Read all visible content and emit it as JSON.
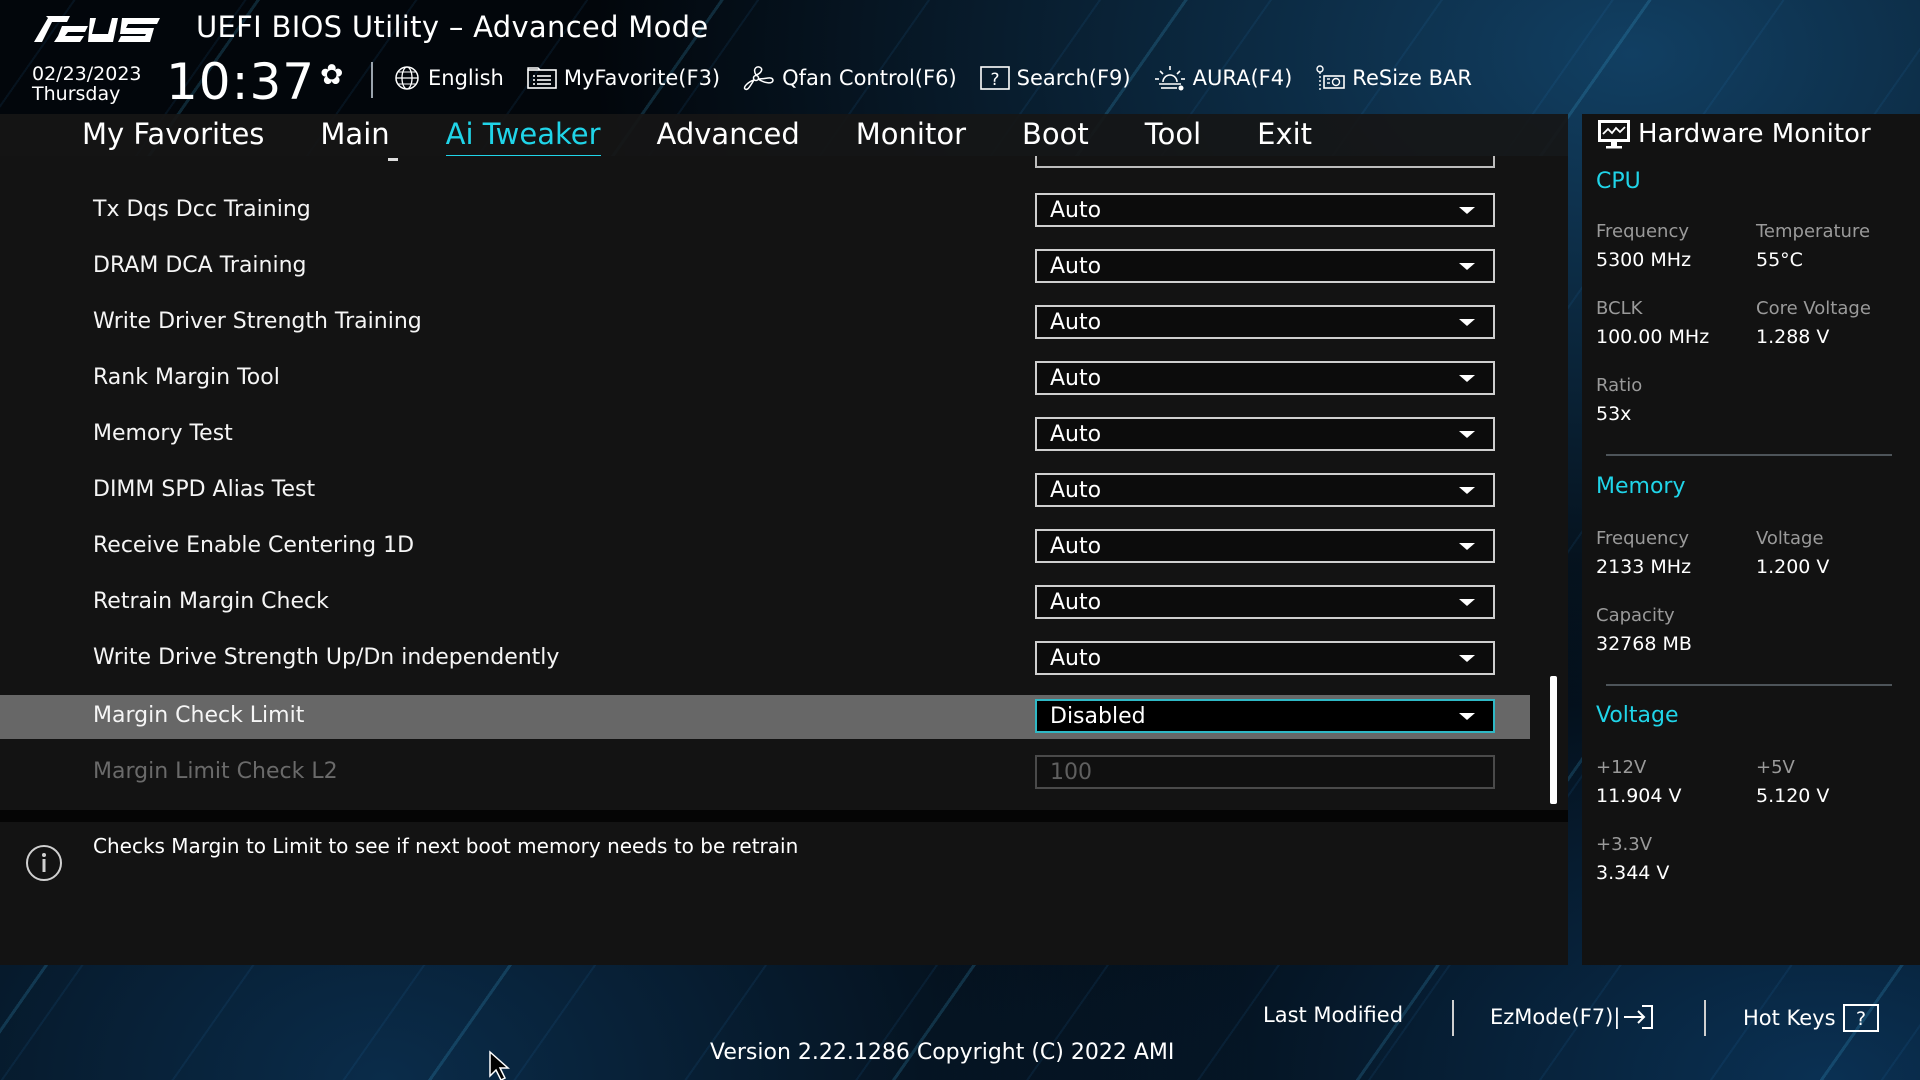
{
  "header": {
    "brand": "ASUS",
    "title": "UEFI BIOS Utility – Advanced Mode",
    "date": "02/23/2023",
    "weekday": "Thursday",
    "time": "10:37",
    "toolbar": [
      {
        "label": "English",
        "icon": "globe-icon"
      },
      {
        "label": "MyFavorite(F3)",
        "icon": "favorite-list-icon"
      },
      {
        "label": "Qfan Control(F6)",
        "icon": "fan-icon"
      },
      {
        "label": "Search(F9)",
        "icon": "question-box-icon"
      },
      {
        "label": "AURA(F4)",
        "icon": "aura-light-icon"
      },
      {
        "label": "ReSize BAR",
        "icon": "gpu-card-icon"
      }
    ]
  },
  "nav": {
    "tabs": [
      {
        "label": "My Favorites",
        "active": false
      },
      {
        "label": "Main",
        "active": false
      },
      {
        "label": "Ai Tweaker",
        "active": true
      },
      {
        "label": "Advanced",
        "active": false
      },
      {
        "label": "Monitor",
        "active": false
      },
      {
        "label": "Boot",
        "active": false
      },
      {
        "label": "Tool",
        "active": false
      },
      {
        "label": "Exit",
        "active": false
      }
    ],
    "accent_color": "#20d4e8"
  },
  "settings": [
    {
      "label": "Tx Dqs Dcc Training",
      "value": "Auto",
      "type": "dropdown"
    },
    {
      "label": "DRAM DCA Training",
      "value": "Auto",
      "type": "dropdown"
    },
    {
      "label": "Write Driver Strength Training",
      "value": "Auto",
      "type": "dropdown"
    },
    {
      "label": "Rank Margin Tool",
      "value": "Auto",
      "type": "dropdown"
    },
    {
      "label": "Memory Test",
      "value": "Auto",
      "type": "dropdown"
    },
    {
      "label": "DIMM SPD Alias Test",
      "value": "Auto",
      "type": "dropdown"
    },
    {
      "label": "Receive Enable Centering 1D",
      "value": "Auto",
      "type": "dropdown"
    },
    {
      "label": "Retrain Margin Check",
      "value": "Auto",
      "type": "dropdown"
    },
    {
      "label": "Write Drive Strength Up/Dn independently",
      "value": "Auto",
      "type": "dropdown"
    },
    {
      "label": "Margin Check Limit",
      "value": "Disabled",
      "type": "dropdown",
      "selected": true
    },
    {
      "label": "Margin Limit Check L2",
      "value": "100",
      "type": "text",
      "disabled": true
    }
  ],
  "help": {
    "text": "Checks Margin to Limit to see if next boot memory needs to be retrain"
  },
  "hardware_monitor": {
    "title": "Hardware Monitor",
    "cpu": {
      "title": "CPU",
      "frequency_label": "Frequency",
      "frequency": "5300 MHz",
      "temperature_label": "Temperature",
      "temperature": "55°C",
      "bclk_label": "BCLK",
      "bclk": "100.00 MHz",
      "core_voltage_label": "Core Voltage",
      "core_voltage": "1.288 V",
      "ratio_label": "Ratio",
      "ratio": "53x"
    },
    "memory": {
      "title": "Memory",
      "frequency_label": "Frequency",
      "frequency": "2133 MHz",
      "voltage_label": "Voltage",
      "voltage": "1.200 V",
      "capacity_label": "Capacity",
      "capacity": "32768 MB"
    },
    "voltage": {
      "title": "Voltage",
      "v12_label": "+12V",
      "v12": "11.904 V",
      "v5_label": "+5V",
      "v5": "5.120 V",
      "v33_label": "+3.3V",
      "v33": "3.344 V"
    }
  },
  "footer": {
    "last_modified": "Last Modified",
    "ezmode": "EzMode(F7)|",
    "hot_keys": "Hot Keys",
    "version": "Version 2.22.1286 Copyright (C) 2022 AMI"
  }
}
